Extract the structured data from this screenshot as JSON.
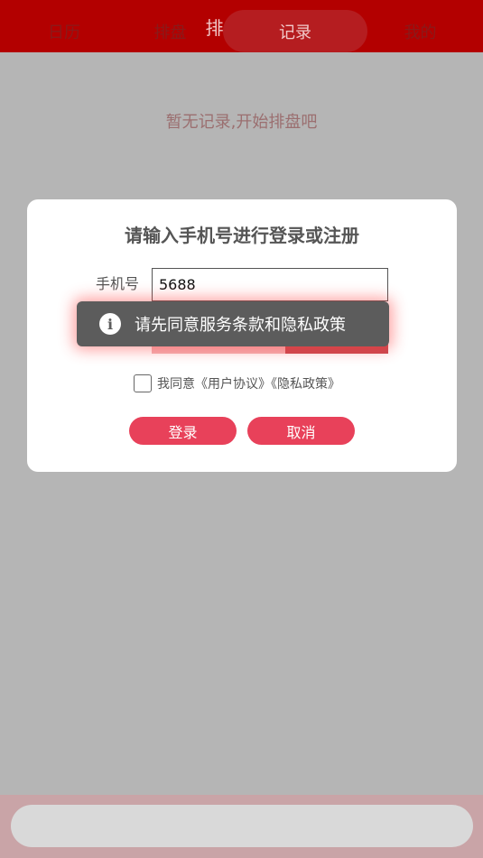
{
  "header": {
    "title": "排盘记录"
  },
  "main": {
    "empty_text": "暂无记录,开始排盘吧"
  },
  "login_dialog": {
    "title": "请输入手机号进行登录或注册",
    "phone_label": "手机号",
    "phone_value": "5688",
    "agree_text": "我同意《用户协议》《隐私政策》",
    "agree_checked": false,
    "login_label": "登录",
    "cancel_label": "取消"
  },
  "toast": {
    "icon": "info-icon",
    "message": "请先同意服务条款和隐私政策"
  },
  "tabbar": {
    "items": [
      {
        "label": "日历",
        "active": false
      },
      {
        "label": "排盘",
        "active": false
      },
      {
        "label": "记录",
        "active": true
      },
      {
        "label": "我的",
        "active": false
      }
    ]
  },
  "colors": {
    "header_bg": "#b30000",
    "accent_button": "#e8415a",
    "active_tab_bg": "#b51d20",
    "toast_bg": "#5c5c5c"
  }
}
